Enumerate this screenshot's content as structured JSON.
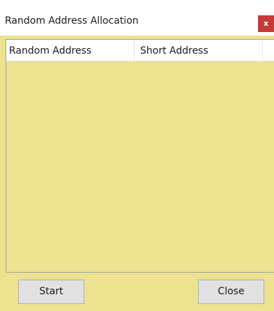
{
  "window": {
    "title": "Random Address Allocation",
    "close_glyph": "x",
    "background_color": "#ede290",
    "close_color": "#c43a3a"
  },
  "list": {
    "columns": [
      "Random Address",
      "Short Address",
      ""
    ],
    "rows": []
  },
  "buttons": {
    "start_label": "Start",
    "close_label": "Close"
  }
}
